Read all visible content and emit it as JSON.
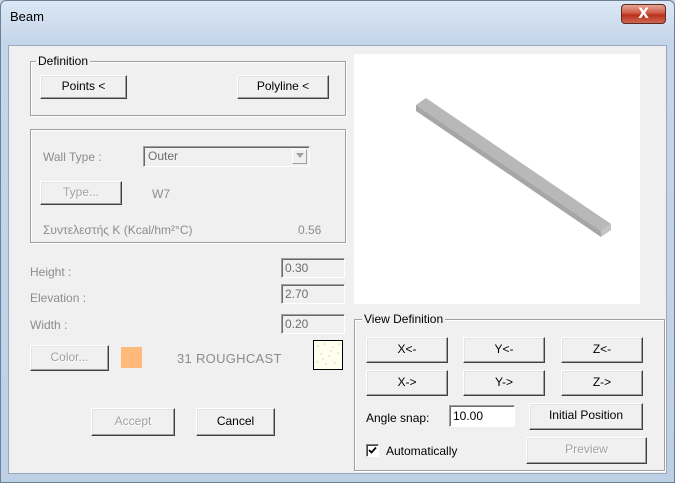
{
  "window": {
    "title": "Beam",
    "close_label": "X"
  },
  "definition": {
    "legend": "Definition",
    "points_button": "Points <",
    "polyline_button": "Polyline <"
  },
  "wall": {
    "type_label": "Wall Type :",
    "type_value": "Outer",
    "type_button": "Type...",
    "type_code": "W7",
    "k_label": "Συντελεστής K (Kcal/hm²°C)",
    "k_value": "0.56"
  },
  "dimensions": {
    "height_label": "Height :",
    "height_value": "0.30",
    "elevation_label": "Elevation :",
    "elevation_value": "2.70",
    "width_label": "Width :",
    "width_value": "0.20"
  },
  "color": {
    "button": "Color...",
    "swatch_hex": "#ffb97a",
    "name": "31 ROUGHCAST"
  },
  "actions": {
    "accept": "Accept",
    "cancel": "Cancel"
  },
  "view": {
    "legend": "View Definition",
    "x_neg": "X<-",
    "y_neg": "Y<-",
    "z_neg": "Z<-",
    "x_pos": "X->",
    "y_pos": "Y->",
    "z_pos": "Z->",
    "angle_label": "Angle snap:",
    "angle_value": "10.00",
    "initial_position": "Initial Position",
    "auto_label": "Automatically",
    "auto_checked": true,
    "preview": "Preview"
  }
}
